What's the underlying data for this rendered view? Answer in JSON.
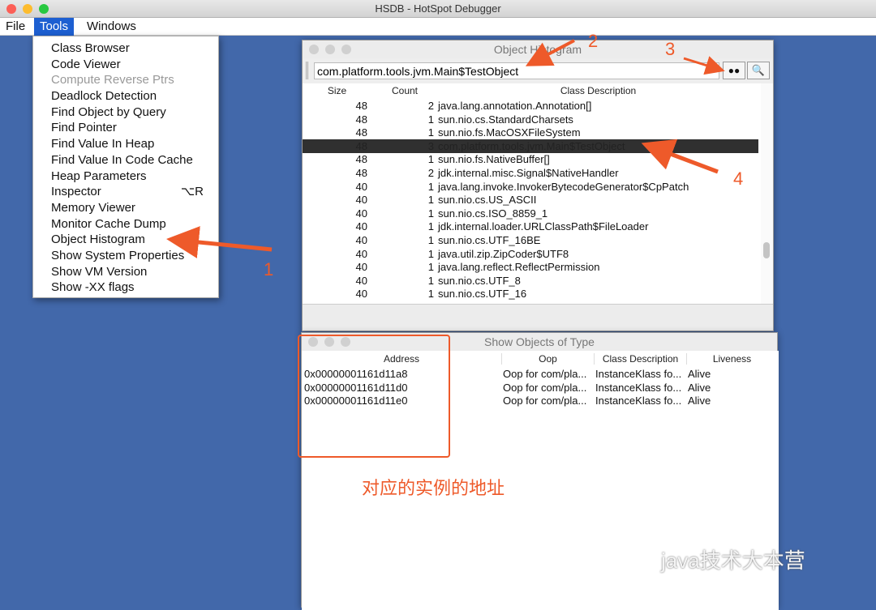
{
  "window": {
    "title": "HSDB - HotSpot Debugger"
  },
  "menubar": [
    "File",
    "Tools",
    "Windows"
  ],
  "tools_menu": [
    {
      "label": "Class Browser"
    },
    {
      "label": "Code Viewer"
    },
    {
      "label": "Compute Reverse Ptrs",
      "disabled": true
    },
    {
      "label": "Deadlock Detection"
    },
    {
      "label": "Find Object by Query"
    },
    {
      "label": "Find Pointer"
    },
    {
      "label": "Find Value In Heap"
    },
    {
      "label": "Find Value In Code Cache"
    },
    {
      "label": "Heap Parameters"
    },
    {
      "label": "Inspector",
      "shortcut": "⌥R"
    },
    {
      "label": "Memory Viewer"
    },
    {
      "label": "Monitor Cache Dump"
    },
    {
      "label": "Object Histogram"
    },
    {
      "label": "Show System Properties"
    },
    {
      "label": "Show VM Version"
    },
    {
      "label": "Show -XX flags"
    }
  ],
  "histogram": {
    "title": "Object Histogram",
    "search_value": "com.platform.tools.jvm.Main$TestObject",
    "find_icon": "binoculars-icon",
    "inspect_icon": "magnifier-icon",
    "columns": [
      "Size",
      "Count",
      "Class Description"
    ],
    "rows": [
      [
        "48",
        "2",
        "java.lang.annotation.Annotation[]"
      ],
      [
        "48",
        "1",
        "sun.nio.cs.StandardCharsets"
      ],
      [
        "48",
        "1",
        "sun.nio.fs.MacOSXFileSystem"
      ],
      [
        "48",
        "3",
        "com.platform.tools.jvm.Main$TestObject"
      ],
      [
        "48",
        "1",
        "sun.nio.fs.NativeBuffer[]"
      ],
      [
        "48",
        "2",
        "jdk.internal.misc.Signal$NativeHandler"
      ],
      [
        "40",
        "1",
        "java.lang.invoke.InvokerBytecodeGenerator$CpPatch"
      ],
      [
        "40",
        "1",
        "sun.nio.cs.US_ASCII"
      ],
      [
        "40",
        "1",
        "sun.nio.cs.ISO_8859_1"
      ],
      [
        "40",
        "1",
        "jdk.internal.loader.URLClassPath$FileLoader"
      ],
      [
        "40",
        "1",
        "sun.nio.cs.UTF_16BE"
      ],
      [
        "40",
        "1",
        "java.util.zip.ZipCoder$UTF8"
      ],
      [
        "40",
        "1",
        "java.lang.reflect.ReflectPermission"
      ],
      [
        "40",
        "1",
        "sun.nio.cs.UTF_8"
      ],
      [
        "40",
        "1",
        "sun.nio.cs.UTF_16"
      ]
    ],
    "selected_row": 3
  },
  "objects": {
    "title": "Show Objects of Type",
    "columns": [
      "Address",
      "Oop",
      "Class Description",
      "Liveness"
    ],
    "rows": [
      [
        "0x00000001161d11a8",
        "Oop for com/pla...",
        "InstanceKlass fo...",
        "Alive"
      ],
      [
        "0x00000001161d11d0",
        "Oop for com/pla...",
        "InstanceKlass fo...",
        "Alive"
      ],
      [
        "0x00000001161d11e0",
        "Oop for com/pla...",
        "InstanceKlass fo...",
        "Alive"
      ]
    ]
  },
  "annotations": {
    "n1": "1",
    "n2": "2",
    "n3": "3",
    "n4": "4",
    "caption": "对应的实例的地址",
    "accent": "#ee5a2a"
  },
  "watermark": "java技术大本营"
}
